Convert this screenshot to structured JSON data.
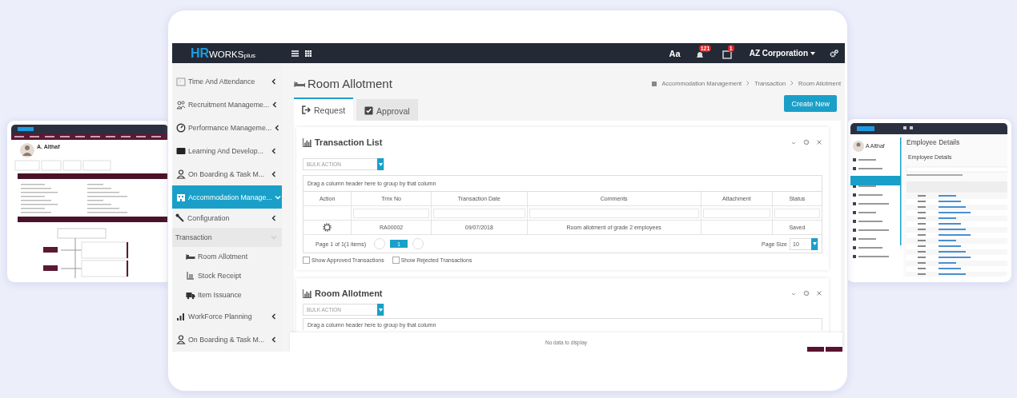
{
  "left_preview": {
    "name": "A. Althaf"
  },
  "right_preview": {
    "user": "A Althaf",
    "page_title": "Employee Details",
    "section_title": "Employee Details"
  },
  "header": {
    "logo": {
      "main": "HR",
      "sub": "WORKS",
      "suffix": "plus"
    },
    "font_button": "Aa",
    "notification_count": "121",
    "calendar_count": "1",
    "company": "AZ Corporation"
  },
  "sidebar": {
    "items": [
      {
        "label": "Time And Attendance",
        "selected": false,
        "expanded": false
      },
      {
        "label": "Recruitment Manageme...",
        "selected": false,
        "expanded": false
      },
      {
        "label": "Performance Manageme...",
        "selected": false,
        "expanded": false
      },
      {
        "label": "Learning And Develop...",
        "selected": false,
        "expanded": false
      },
      {
        "label": "On Boarding & Task M...",
        "selected": false,
        "expanded": false
      },
      {
        "label": "Accommodation Manage...",
        "selected": true,
        "expanded": true,
        "children": [
          {
            "label": "Configuration",
            "selected": false,
            "expanded": false
          },
          {
            "label": "Transaction",
            "selected": true,
            "expanded": true,
            "children": [
              {
                "label": "Room Allotment"
              },
              {
                "label": "Stock Receipt"
              },
              {
                "label": "Item Issuance"
              }
            ]
          }
        ]
      },
      {
        "label": "WorkForce Planning",
        "selected": false,
        "expanded": false
      },
      {
        "label": "On Boarding & Task M...",
        "selected": false,
        "expanded": false
      }
    ]
  },
  "page": {
    "title": "Room Allotment",
    "breadcrumb": [
      "Accommodation Management",
      "Transaction",
      "Room Allotment"
    ],
    "tabs": [
      {
        "label": "Request",
        "selected": true
      },
      {
        "label": "Approval",
        "selected": false
      }
    ],
    "create_button": "Create New"
  },
  "panels": [
    {
      "title": "Transaction List",
      "bulk_action": "BULK ACTION",
      "group_hint": "Drag a column header here to group by that column",
      "columns": [
        {
          "label": "Action",
          "kind": "action"
        },
        {
          "label": "Trnx No",
          "kind": "text"
        },
        {
          "label": "Transaction Date",
          "kind": "text"
        },
        {
          "label": "Comments",
          "kind": "text"
        },
        {
          "label": "Attachment",
          "kind": "attachment"
        },
        {
          "label": "Status",
          "kind": "text"
        }
      ],
      "rows": [
        {
          "cells": [
            "",
            "RA00002",
            "09/07/2018",
            "Room allotment of grade 2 employees",
            "",
            "Saved"
          ]
        }
      ],
      "pager": {
        "info": "Page 1 of 1(1 items)",
        "page": "1",
        "page_size_label": "Page Size",
        "page_size": "10"
      },
      "checkboxes": [
        {
          "label": "Show Approved Transactions",
          "checked": false
        },
        {
          "label": "Show Rejected Transactions",
          "checked": false
        }
      ]
    },
    {
      "title": "Room Allotment",
      "bulk_action": "BULK ACTION",
      "group_hint": "Drag a column header here to group by that column"
    }
  ],
  "empty_message": "No data to display"
}
